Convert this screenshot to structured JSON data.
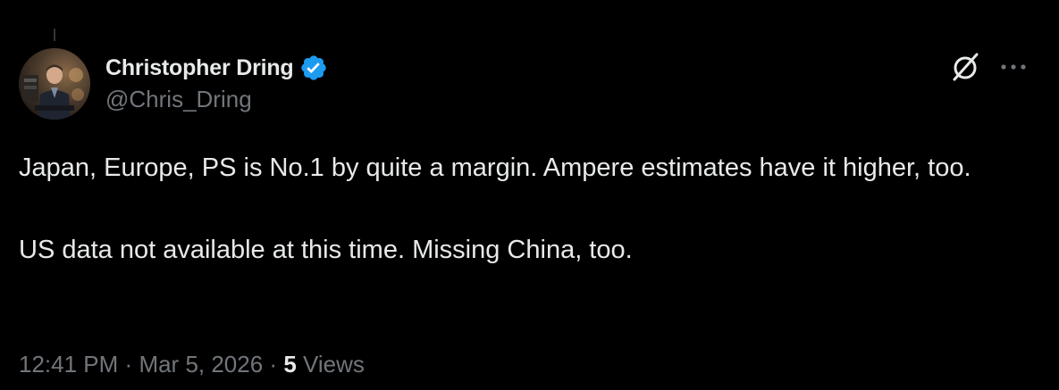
{
  "tweet": {
    "author": {
      "display_name": "Christopher Dring",
      "handle": "@Chris_Dring",
      "verified": true,
      "verified_color": "#1d9bf0"
    },
    "text_paragraphs": [
      "Japan, Europe, PS is No.1 by quite a margin. Ampere estimates have it higher, too.",
      "US data not available at this time. Missing China, too."
    ],
    "meta": {
      "time": "12:41 PM",
      "separator": "·",
      "date": "Mar 5, 2026",
      "views_count": "5",
      "views_label": "Views"
    },
    "icons": {
      "avatar": "profile-photo",
      "verified": "verified-badge-icon",
      "grok": "grok-icon",
      "more": "more-horizontal-icon"
    }
  },
  "colors": {
    "background": "#000000",
    "text_primary": "#e7e9ea",
    "text_secondary": "#71767b",
    "thread_line": "#333639"
  }
}
